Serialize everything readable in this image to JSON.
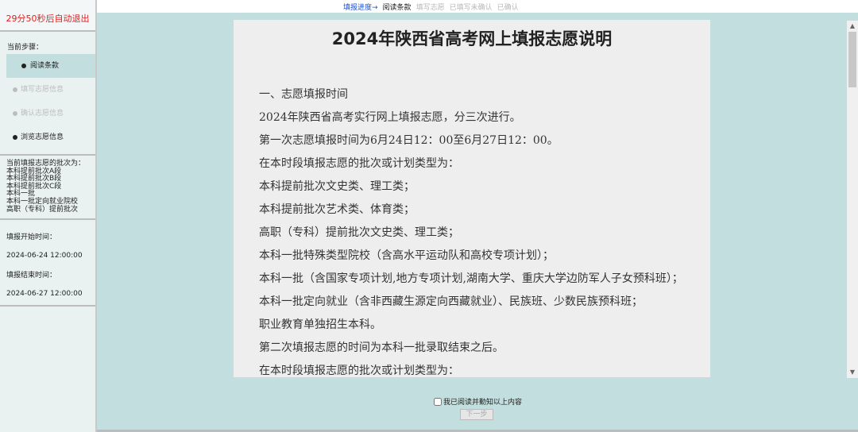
{
  "topbar": {
    "progress_label": "填报进度→",
    "steps": [
      "阅读条款",
      "填写志愿",
      "已填写未确认",
      "已确认"
    ]
  },
  "sidebar": {
    "timer": "29分50秒后自动退出",
    "current_step_label": "当前步骤：",
    "nav": [
      "阅读条款",
      "填写志愿信息",
      "确认志愿信息",
      "浏览志愿信息"
    ],
    "batches_label": "当前填报志愿的批次为：",
    "batches": [
      "本科提前批次A段",
      "本科提前批次B段",
      "本科提前批次C段",
      "本科一批",
      "本科一批定向就业院校",
      "高职（专科）提前批次"
    ],
    "start_label": "填报开始时间：",
    "start_value": "2024-06-24 12:00:00",
    "end_label": "填报结束时间：",
    "end_value": "2024-06-27 12:00:00"
  },
  "doc": {
    "title": "2024年陕西省高考网上填报志愿说明",
    "paragraphs": [
      "一、志愿填报时间",
      "2024年陕西省高考实行网上填报志愿，分三次进行。",
      "第一次志愿填报时间为6月24日12：00至6月27日12：00。",
      "在本时段填报志愿的批次或计划类型为：",
      "本科提前批次文史类、理工类；",
      "本科提前批次艺术类、体育类；",
      "高职（专科）提前批次文史类、理工类；",
      "本科一批特殊类型院校（含高水平运动队和高校专项计划）；",
      "本科一批（含国家专项计划,地方专项计划,湖南大学、重庆大学边防军人子女预科班）；",
      "本科一批定向就业（含非西藏生源定向西藏就业）、民族班、少数民族预科班；",
      "职业教育单独招生本科。",
      "第二次填报志愿的时间为本科一批录取结束之后。",
      "在本时段填报志愿的批次或计划类型为："
    ]
  },
  "footer": {
    "agree_label": "我已阅读并勤知以上内容",
    "next_label": "下一步"
  }
}
